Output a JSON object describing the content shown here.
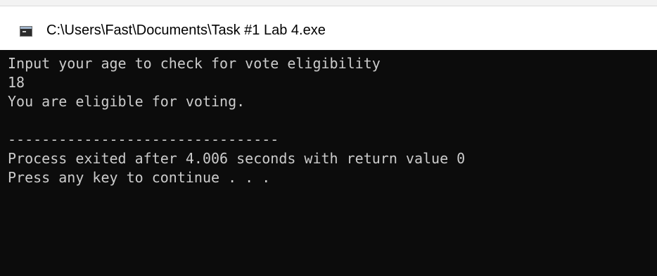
{
  "window": {
    "title": "C:\\Users\\Fast\\Documents\\Task #1 Lab 4.exe",
    "icon": "console-app-icon"
  },
  "console": {
    "lines": [
      "Input your age to check for vote eligibility",
      "18",
      "You are eligible for voting.",
      "",
      "--------------------------------",
      "Process exited after 4.006 seconds with return value 0",
      "Press any key to continue . . ."
    ]
  },
  "colors": {
    "console_background": "#0c0c0c",
    "console_text": "#cccccc",
    "titlebar_background": "#ffffff"
  }
}
